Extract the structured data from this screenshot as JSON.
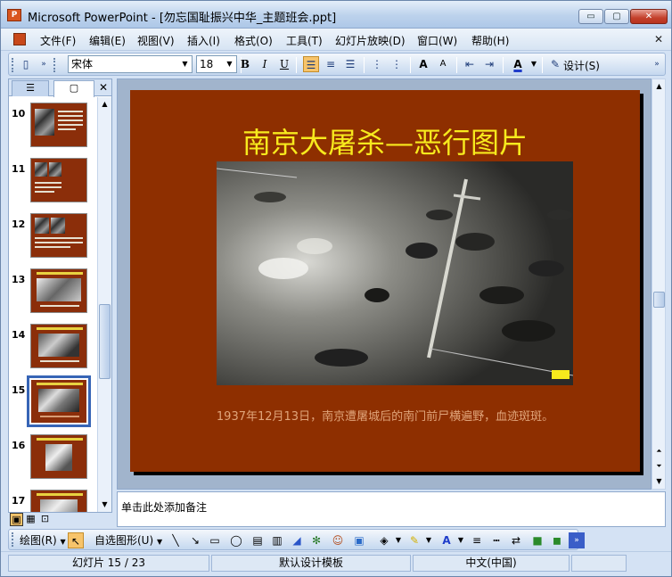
{
  "window": {
    "title": "Microsoft PowerPoint - [勿忘国耻振兴中华_主题班会.ppt]",
    "controls": {
      "minimize": "▭",
      "maximize": "▢",
      "close": "✕"
    }
  },
  "menubar": {
    "items": [
      "文件(F)",
      "编辑(E)",
      "视图(V)",
      "插入(I)",
      "格式(O)",
      "工具(T)",
      "幻灯片放映(D)",
      "窗口(W)",
      "帮助(H)"
    ],
    "close_glyph": "✕"
  },
  "toolbar": {
    "font_name": "宋体",
    "font_size": "18",
    "bold": "B",
    "italic": "I",
    "underline": "U",
    "increase_font": "A",
    "decrease_font": "A",
    "font_color": "A",
    "design_label": "设计(S)"
  },
  "slides_pane": {
    "tabs": [
      "outline-icon",
      "slides-icon"
    ],
    "close_glyph": "✕",
    "thumbnails": [
      {
        "number": "10"
      },
      {
        "number": "11"
      },
      {
        "number": "12"
      },
      {
        "number": "13"
      },
      {
        "number": "14"
      },
      {
        "number": "15",
        "selected": true
      },
      {
        "number": "16"
      },
      {
        "number": "17"
      }
    ]
  },
  "slide": {
    "title": "南京大屠杀—恶行图片",
    "caption": "1937年12月13日，南京遭屠城后的南门前尸横遍野，血迹斑斑。",
    "background_color": "#8e2f00",
    "title_color": "#f7ea1d",
    "caption_color": "#e0a47a"
  },
  "notes": {
    "placeholder": "单击此处添加备注"
  },
  "drawing_toolbar": {
    "draw_label": "绘图(R)",
    "autoshapes_label": "自选图形(U)"
  },
  "statusbar": {
    "slide_position": "幻灯片 15 / 23",
    "template": "默认设计模板",
    "language": "中文(中国)"
  }
}
